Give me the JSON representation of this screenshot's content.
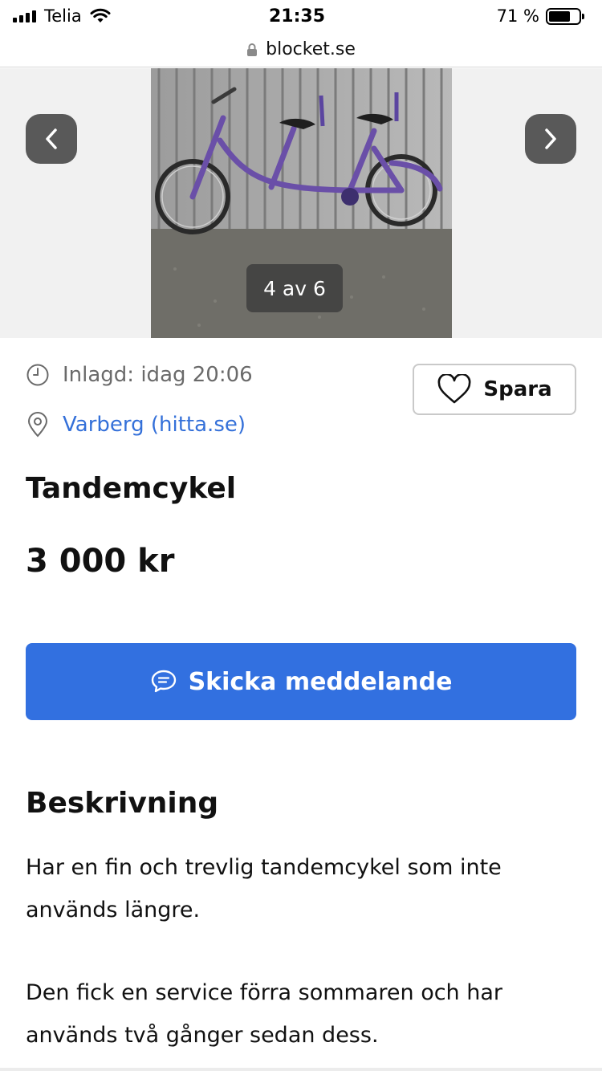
{
  "status_bar": {
    "carrier": "Telia",
    "time": "21:35",
    "battery_text": "71 %",
    "battery_level": 0.71
  },
  "url_bar": {
    "domain": "blocket.se"
  },
  "gallery": {
    "counter": "4 av 6",
    "prev_icon": "chevron-left-icon",
    "next_icon": "chevron-right-icon"
  },
  "listing": {
    "posted": "Inlagd: idag 20:06",
    "location": "Varberg (hitta.se)",
    "save_label": "Spara",
    "title": "Tandemcykel",
    "price": "3 000 kr",
    "message_label": "Skicka meddelande"
  },
  "description": {
    "heading": "Beskrivning",
    "paragraphs": [
      "Har en fin och trevlig tandemcykel som inte används längre.",
      "Den fick en service förra sommaren och har används två gånger sedan dess."
    ]
  },
  "colors": {
    "accent_blue": "#3270e0",
    "link_blue": "#3470d9",
    "muted_text": "#6a6a6a"
  }
}
